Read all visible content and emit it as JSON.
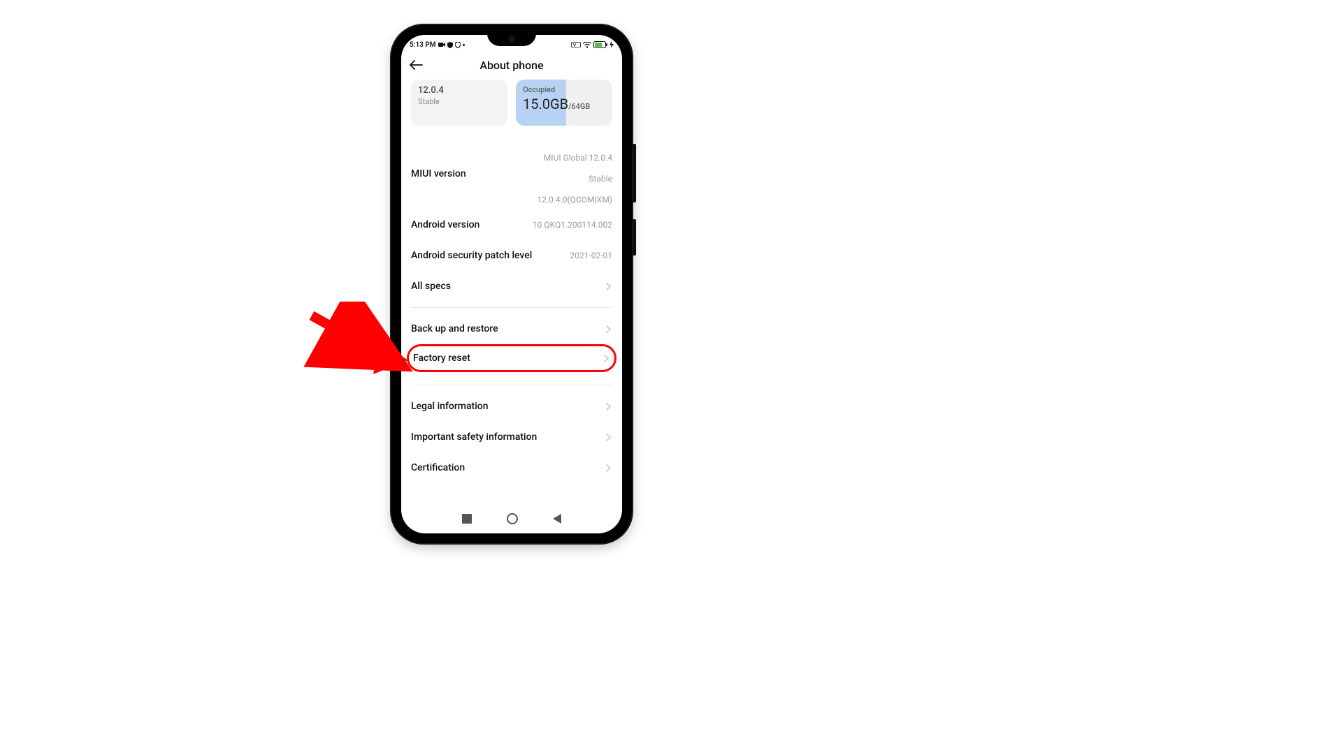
{
  "status": {
    "time": "5:13 PM"
  },
  "title": "About phone",
  "card_version": {
    "main": "12.0.4",
    "sub": "Stable"
  },
  "card_storage": {
    "label": "Occupied",
    "used": "15.0GB",
    "total": "/64GB"
  },
  "rows": {
    "miui_label": "MIUI version",
    "miui_val_l1": "MIUI Global 12.0.4",
    "miui_val_l2": "Stable",
    "miui_val_l3": "12.0.4.0(QCOMIXM)",
    "android_label": "Android version",
    "android_val": "10 QKQ1.200114.002",
    "patch_label": "Android security patch level",
    "patch_val": "2021-02-01",
    "specs_label": "All specs",
    "backup_label": "Back up and restore",
    "factory_label": "Factory reset",
    "legal_label": "Legal information",
    "safety_label": "Important safety information",
    "cert_label": "Certification"
  }
}
